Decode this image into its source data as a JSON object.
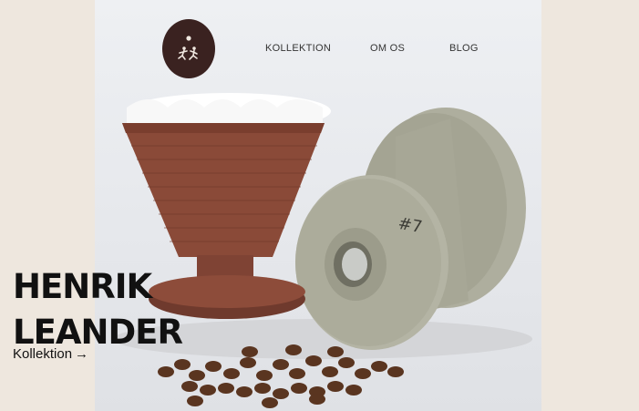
{
  "brand": {
    "logo_icon": "runners-logo-icon"
  },
  "nav": {
    "items": [
      {
        "label": "KOLLEKTION"
      },
      {
        "label": "OM OS"
      },
      {
        "label": "BLOG"
      }
    ]
  },
  "hero": {
    "title_line1": "HENRIK",
    "title_line2": "LEANDER",
    "link_label": "Kollektion",
    "link_arrow": "→"
  },
  "colors": {
    "page_bg": "#eee7de",
    "logo_bg": "#3a2220",
    "dripper_clay": "#8a4a38",
    "dripper_stone": "#a9aa99"
  }
}
